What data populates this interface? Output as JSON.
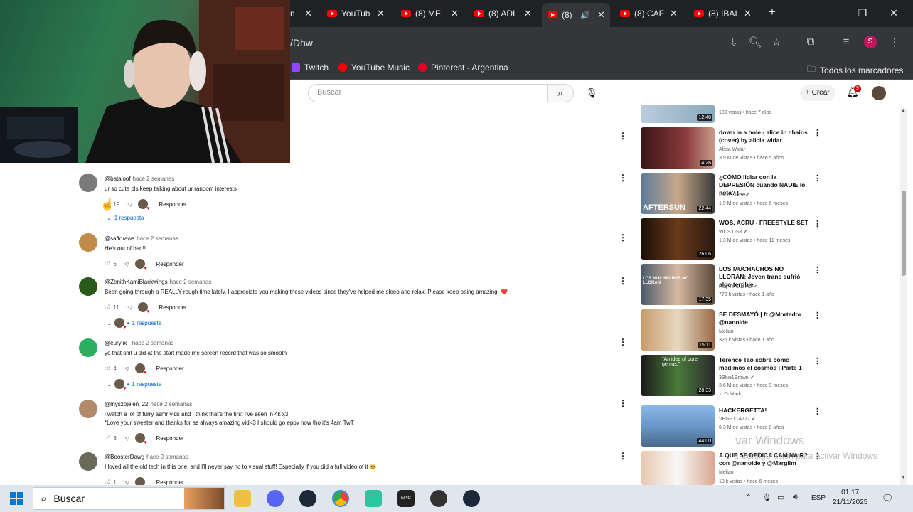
{
  "tabs": [
    {
      "label": "n"
    },
    {
      "label": "YouTub"
    },
    {
      "label": "(8) ME"
    },
    {
      "label": "(8) ADI"
    },
    {
      "label": "(8)"
    },
    {
      "label": "(8) CAF"
    },
    {
      "label": "(8) IBAI"
    }
  ],
  "address": {
    "url": "/Dhw"
  },
  "bookmarks": [
    {
      "label": "Twitch"
    },
    {
      "label": "YouTube Music"
    },
    {
      "label": "Pinterest - Argentina"
    },
    {
      "label": "Todos los marcadores"
    }
  ],
  "youtube": {
    "search_placeholder": "Buscar",
    "create_label": "Crear",
    "notif_count": "9"
  },
  "comments": [
    {
      "user": "@bataloof",
      "when": "hace 2 semanas",
      "text": "ur so cute pls keep talking about ur random interests",
      "likes": "19",
      "reply_label": "Responder",
      "replies": "1 respuesta"
    },
    {
      "user": "@saffdraws",
      "when": "hace 2 semanas",
      "text": "He's out of bed!!",
      "likes": "6",
      "reply_label": "Responder",
      "replies": ""
    },
    {
      "user": "@ZenithKamiBlackwings",
      "when": "hace 2 semanas",
      "text": "Been going through a REALLY rough time lately. I appreciate you making these videos since they've helped me sleep and relax. Please keep being amazing. ❤️",
      "likes": "11",
      "reply_label": "Responder",
      "replies": "1 respuesta"
    },
    {
      "user": "@eurylix_",
      "when": "hace 2 semanas",
      "text": "yo that shit u did at the start made me screen record that was so smooth",
      "likes": "4",
      "reply_label": "Responder",
      "replies": "1 respuesta"
    },
    {
      "user": "@myszojelen_22",
      "when": "hace 2 semanas",
      "text": "i watch a lot of furry asmr vids and I think that's the first I've seen in 4k x3\n*Love your sweater and thanks for as always amazing vid<3 I should go eppy now tho it's 4am TwT",
      "likes": "3",
      "reply_label": "Responder",
      "replies": ""
    },
    {
      "user": "@BoosterDawg",
      "when": "hace 2 semanas",
      "text": "I loved all the old tech in this one, and I'll never say no to visual stuff! Especially if you did a full video of it 🐱",
      "likes": "1",
      "reply_label": "Responder",
      "replies": ""
    }
  ],
  "sidebar": [
    {
      "title": "",
      "channel": "",
      "meta": "180 vistas • hace 7 días",
      "duration": "12:48"
    },
    {
      "title": "down in a hole - alice in chains (cover) by alicia widar",
      "channel": "Alicia Widar",
      "meta": "3.9 M de vistas • hace 5 años",
      "duration": "4:26"
    },
    {
      "title": "¿CÓMO lidiar con la DEPRESIÓN cuando NADIE lo nota? | ...",
      "channel": "Farid Dieck",
      "meta": "1.9 M de vistas • hace 6 meses",
      "duration": "22:44",
      "thumb_text": "AFTERSUN"
    },
    {
      "title": "WOS, ACRU - FREESTYLE SET",
      "channel": "WOS DS3",
      "meta": "1.3 M de vistas • hace 11 meses",
      "duration": "26:06"
    },
    {
      "title": "LOS MUCHACHOS NO LLORAN: Joven trans sufrió algo terrible",
      "channel": "Hoy Te Cuento",
      "meta": "773 k vistas • hace 1 año",
      "duration": "17:35",
      "thumb_text": "LOS MUCHACHOS NO LLORAN"
    },
    {
      "title": "SE DESMAYÓ | ft @Mortedor @nanoide",
      "channel": "Melian",
      "meta": "325 k vistas • hace 1 año",
      "duration": "15:11"
    },
    {
      "title": "Terence Tao sobre cómo medimos el cosmos | Parte 1",
      "channel": "3Blue1Brown",
      "meta": "3.6 M de vistas • hace 9 meses",
      "duration": "28:33",
      "badge": "Doblado",
      "thumb_text": "\"An idea of pure genius.\""
    },
    {
      "title": "HACKERGETTA!",
      "channel": "VEGETTA777",
      "meta": "6.3 M de vistas • hace 8 años",
      "duration": "44:00"
    },
    {
      "title": "A QUE SE DEDICA CAM NAIR? con @nanoide y @Margiim",
      "channel": "Melian",
      "meta": "19 k vistas • hace 6 meses",
      "duration": ""
    }
  ],
  "watermark": {
    "line1": "var Windows",
    "line2": "Ve a Configuración para activar Windows."
  },
  "taskbar": {
    "search_label": "Buscar",
    "lang": "ESP",
    "time": "01:17",
    "date": "21/11/2025"
  }
}
